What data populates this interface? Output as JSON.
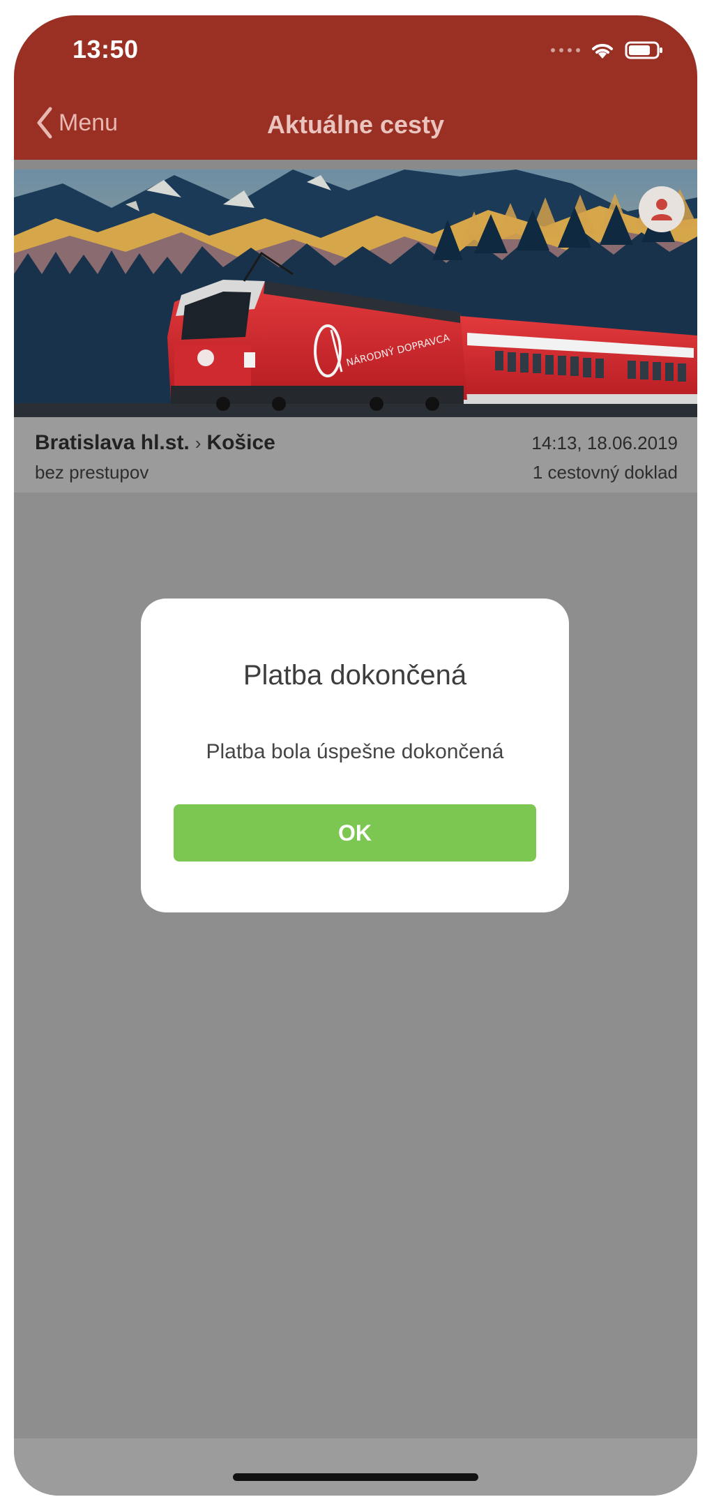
{
  "status_bar": {
    "time": "13:50"
  },
  "nav": {
    "back_label": "Menu",
    "title": "Aktuálne cesty"
  },
  "trip": {
    "from": "Bratislava hl.st.",
    "arrow": "›",
    "to": "Košice",
    "datetime": "14:13, 18.06.2019",
    "transfers": "bez prestupov",
    "documents": "1 cestovný doklad"
  },
  "dialog": {
    "title": "Platba dokončená",
    "message": "Platba bola úspešne dokončená",
    "ok_label": "OK"
  },
  "colors": {
    "header": "#9a3023",
    "overlay": "#8e8e8e",
    "ok_button": "#7bc751",
    "train_red": "#d1262e"
  },
  "icons": [
    "chevron-left-icon",
    "wifi-icon",
    "battery-icon",
    "user-icon"
  ]
}
